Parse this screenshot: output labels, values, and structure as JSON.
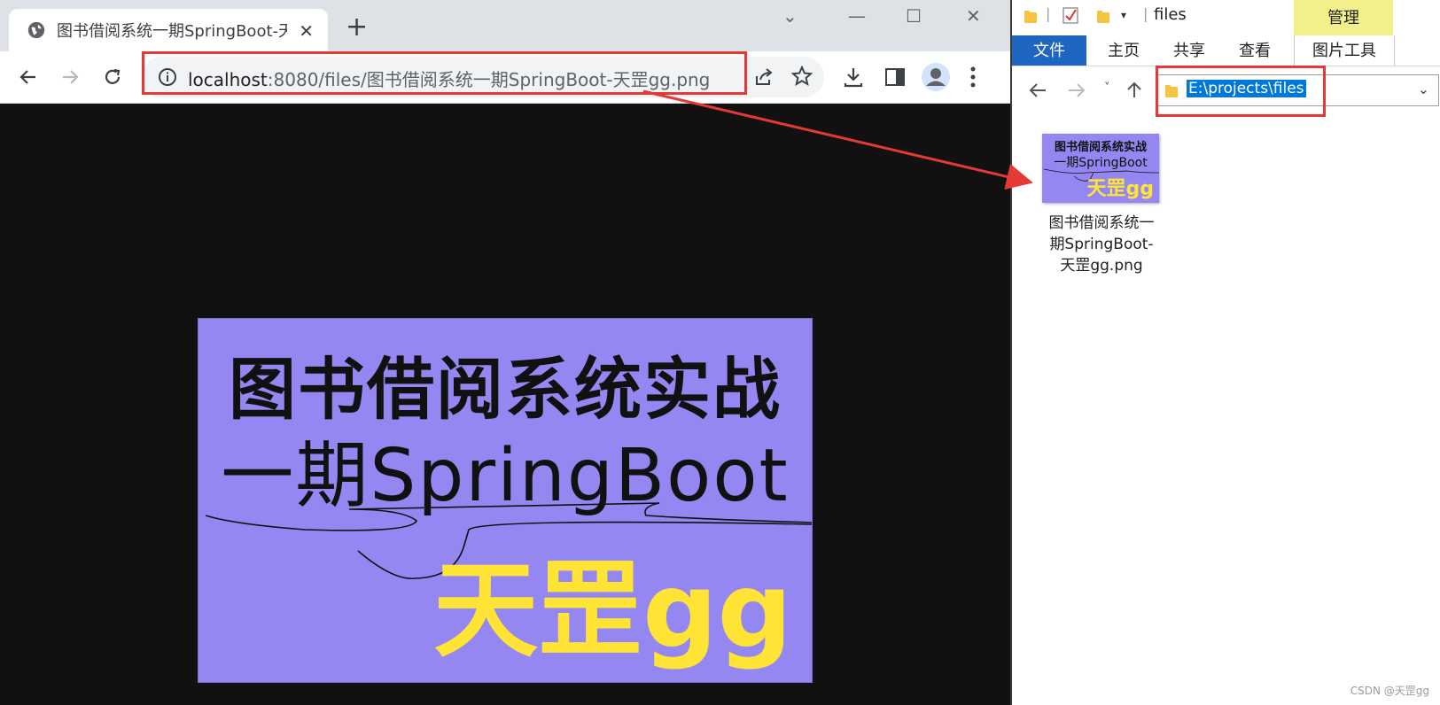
{
  "browser": {
    "tab_title": "图书借阅系统一期SpringBoot-天罡gg.png",
    "url_host": "localhost",
    "url_rest": ":8080/files/图书借阅系统一期SpringBoot-天罡gg.png"
  },
  "image": {
    "line1": "图书借阅系统实战",
    "line2": "一期SpringBoot",
    "line3": "天罡gg"
  },
  "explorer": {
    "title": "files",
    "manage_tab": "管理",
    "ribbon_tabs": [
      "文件",
      "主页",
      "共享",
      "查看",
      "图片工具"
    ],
    "address_path": "E:\\projects\\files",
    "file": {
      "thumb_line1": "图书借阅系统实战",
      "thumb_line2": "一期SpringBoot",
      "thumb_line3": "天罡gg",
      "name_line1": "图书借阅系统一",
      "name_line2": "期SpringBoot-",
      "name_line3": "天罡gg.png"
    }
  },
  "watermark": "CSDN @天罡gg",
  "colors": {
    "highlight": "#e53935",
    "image_bg": "#9487f2",
    "accent_yellow": "#ffe436",
    "ribbon_active": "#1f66c1"
  }
}
